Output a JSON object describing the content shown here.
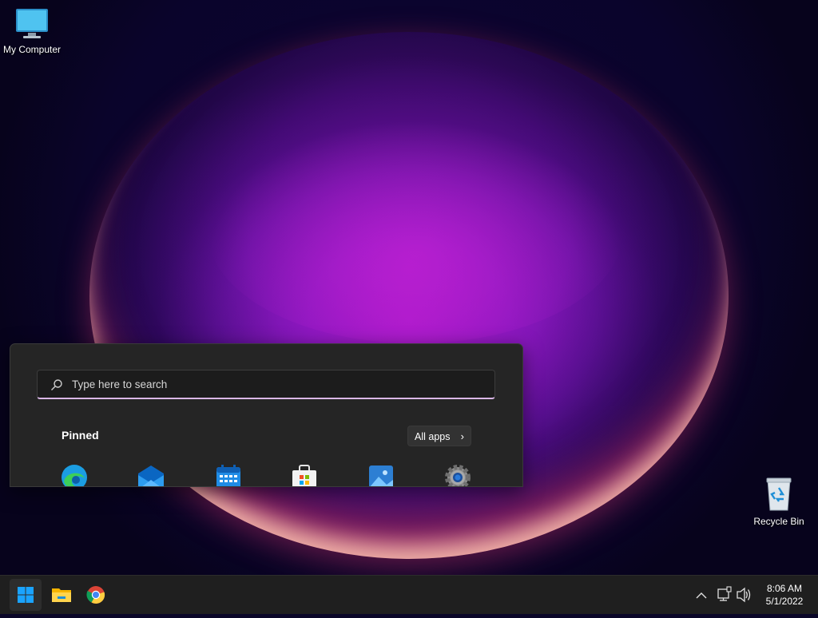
{
  "desktop": {
    "icons": [
      {
        "label": "My Computer",
        "icon": "monitor-icon"
      },
      {
        "label": "Recycle Bin",
        "icon": "recycle-bin-icon"
      }
    ]
  },
  "start_menu": {
    "search_placeholder": "Type here to search",
    "pinned_title": "Pinned",
    "all_apps_label": "All apps",
    "pinned_apps": [
      {
        "icon": "edge-icon"
      },
      {
        "icon": "mail-icon"
      },
      {
        "icon": "calendar-icon"
      },
      {
        "icon": "store-icon"
      },
      {
        "icon": "photos-icon"
      },
      {
        "icon": "settings-icon"
      }
    ]
  },
  "taskbar": {
    "buttons": [
      {
        "icon": "windows-start-icon"
      },
      {
        "icon": "file-explorer-icon"
      },
      {
        "icon": "chrome-icon"
      }
    ],
    "tray": {
      "icons": [
        "chevron-up-icon",
        "network-icon",
        "volume-icon"
      ],
      "time": "8:06 AM",
      "date": "5/1/2022"
    }
  },
  "colors": {
    "accent": "#0078d4",
    "search_underline": "#d9b6e6",
    "taskbar_bg": "#1f1f1f",
    "start_menu_bg": "#252525"
  }
}
